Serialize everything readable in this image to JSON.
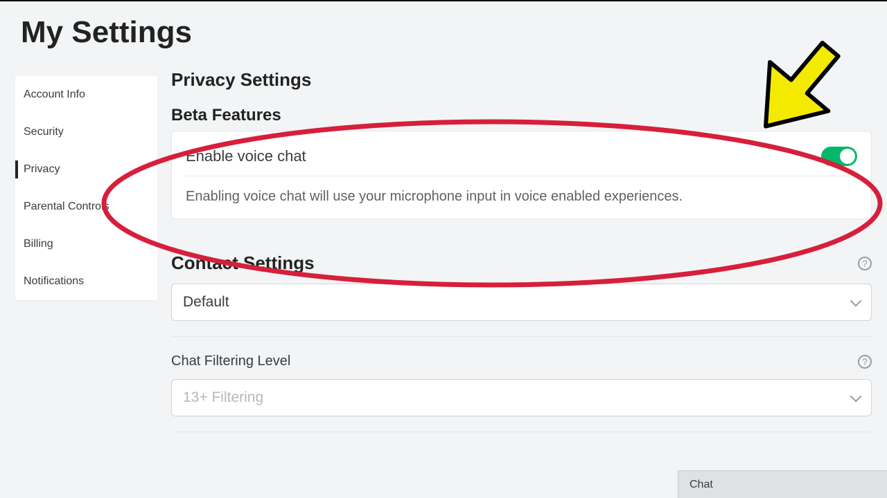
{
  "page_title": "My Settings",
  "sidebar": {
    "items": [
      {
        "label": "Account Info"
      },
      {
        "label": "Security"
      },
      {
        "label": "Privacy",
        "active": true
      },
      {
        "label": "Parental Controls"
      },
      {
        "label": "Billing"
      },
      {
        "label": "Notifications"
      }
    ]
  },
  "privacy": {
    "heading": "Privacy Settings",
    "beta": {
      "heading": "Beta Features",
      "voice_label": "Enable voice chat",
      "voice_desc": "Enabling voice chat will use your microphone input in voice enabled experiences.",
      "voice_enabled": true
    },
    "contact": {
      "heading": "Contact Settings",
      "select_value": "Default"
    },
    "filter": {
      "label": "Chat Filtering Level",
      "select_value": "13+ Filtering"
    }
  },
  "chat_bar": {
    "label": "Chat"
  },
  "annotation": {
    "ellipse_color": "#d61f3a",
    "arrow_fill": "#f4ea00",
    "arrow_stroke": "#000000"
  }
}
